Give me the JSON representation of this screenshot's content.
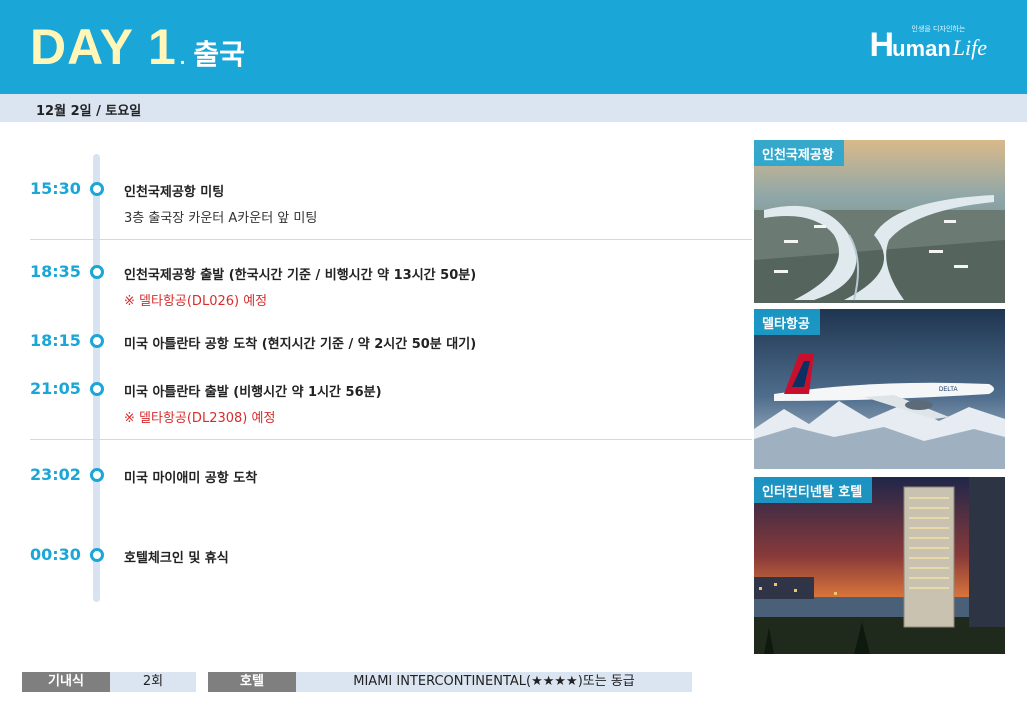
{
  "header": {
    "day_word": "DAY",
    "day_number": "1",
    "day_dot": ".",
    "subtitle": "출국",
    "logo_h": "H",
    "logo_rest": "uman",
    "logo_life": "Life",
    "logo_tagline": "인생을 디자인하는"
  },
  "date_bar": {
    "text": "12월 2일 / 토요일"
  },
  "schedule": [
    {
      "time": "15:30",
      "title": "인천국제공항 미팅",
      "note": "3층 출국장 카운터 A카운터 앞 미팅",
      "note_style": "gray"
    },
    {
      "time": "18:35",
      "title": "인천국제공항 출발 (한국시간 기준 / 비행시간 약 13시간 50분)",
      "note": "※ 델타항공(DL026) 예정",
      "note_style": "red"
    },
    {
      "time": "18:15",
      "title": "미국 아틀란타 공항 도착 (현지시간 기준 / 약 2시간 50분 대기)",
      "note": "",
      "note_style": ""
    },
    {
      "time": "21:05",
      "title": "미국 아틀란타 출발 (비행시간 약 1시간 56분)",
      "note": "※ 델타항공(DL2308) 예정",
      "note_style": "red"
    },
    {
      "time": "23:02",
      "title": "미국 마이애미 공항 도착",
      "note": "",
      "note_style": ""
    },
    {
      "time": "00:30",
      "title": "호텔체크인 및 휴식",
      "note": "",
      "note_style": ""
    }
  ],
  "photos": [
    {
      "label": "인천국제공항",
      "icon": "airport-photo"
    },
    {
      "label": "델타항공",
      "icon": "airplane-photo"
    },
    {
      "label": "인터컨티넨탈 호텔",
      "icon": "hotel-photo"
    }
  ],
  "footer": {
    "meal_label": "기내식",
    "meal_value": "2회",
    "hotel_label": "호텔",
    "hotel_value": "MIAMI INTERCONTINENTAL(★★★★)또는 동급"
  },
  "colors": {
    "accent": "#1aa6d6",
    "title_yellow": "#fff6b8",
    "date_bar": "#dbe5f1",
    "note_red": "#d62e2e",
    "footer_label": "#7f7f7f"
  }
}
